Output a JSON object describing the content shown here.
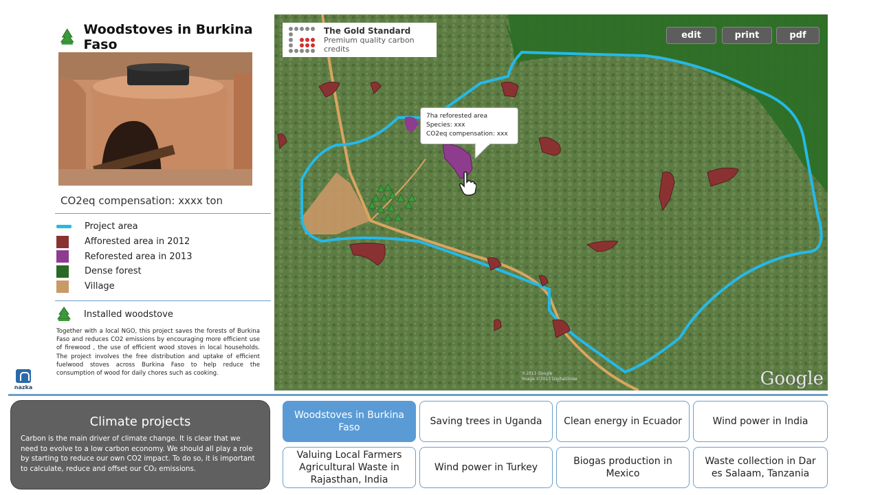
{
  "title": "Woodstoves in Burkina Faso",
  "co2_label": "CO2eq compensation: xxxx ton",
  "legend": [
    {
      "label": "Project area",
      "kind": "line",
      "color": "#25b9e8"
    },
    {
      "label": "Afforested area in 2012",
      "kind": "swatch",
      "color": "#8a3232"
    },
    {
      "label": "Reforested area in 2013",
      "kind": "swatch",
      "color": "#8e3c8e"
    },
    {
      "label": "Dense forest",
      "kind": "swatch",
      "color": "#2a6a26"
    },
    {
      "label": "Village",
      "kind": "swatch",
      "color": "#c99a66"
    }
  ],
  "installed_label": "Installed woodstove",
  "description": "Together with a local NGO, this project saves the forests of Burkina Faso and reduces CO2 emissions by encouraging more efficient use of firewood , the use of efficient wood stoves in local households. The project involves the free distribution and uptake of efficient fuelwood stoves across Burkina Faso to help reduce the consumption of wood for daily chores such as cooking.",
  "brand": "nazka",
  "gold_standard": {
    "title": "The Gold Standard",
    "subtitle": "Premium quality carbon credits"
  },
  "map_buttons": {
    "edit": "edit",
    "print": "print",
    "pdf": "pdf"
  },
  "tooltip": {
    "line1": "7ha reforested area",
    "line2": "Species: xxx",
    "line3": "CO2eq compensation: xxx"
  },
  "google_logo": "Google",
  "map_credit": {
    "line1": "©2013 Google",
    "line2": "Image ©2013 DigitalGlobe"
  },
  "climate": {
    "title": "Climate projects",
    "text": "Carbon is the main driver of climate change. It is clear that we need to evolve to a low carbon economy. We should all play a role by starting to reduce our own CO2 impact. To do so, it is important to calculate, reduce and offset our CO₂ emissions."
  },
  "projects": [
    {
      "label": "Woodstoves in Burkina Faso",
      "active": true
    },
    {
      "label": "Saving trees in Uganda",
      "active": false
    },
    {
      "label": "Clean energy in Ecuador",
      "active": false
    },
    {
      "label": "Wind power in India",
      "active": false
    },
    {
      "label": "Valuing Local Farmers Agricultural Waste in Rajasthan, India",
      "active": false
    },
    {
      "label": "Wind power in Turkey",
      "active": false
    },
    {
      "label": "Biogas production in Mexico",
      "active": false
    },
    {
      "label": "Waste collection in Dar es Salaam, Tanzania",
      "active": false
    }
  ]
}
